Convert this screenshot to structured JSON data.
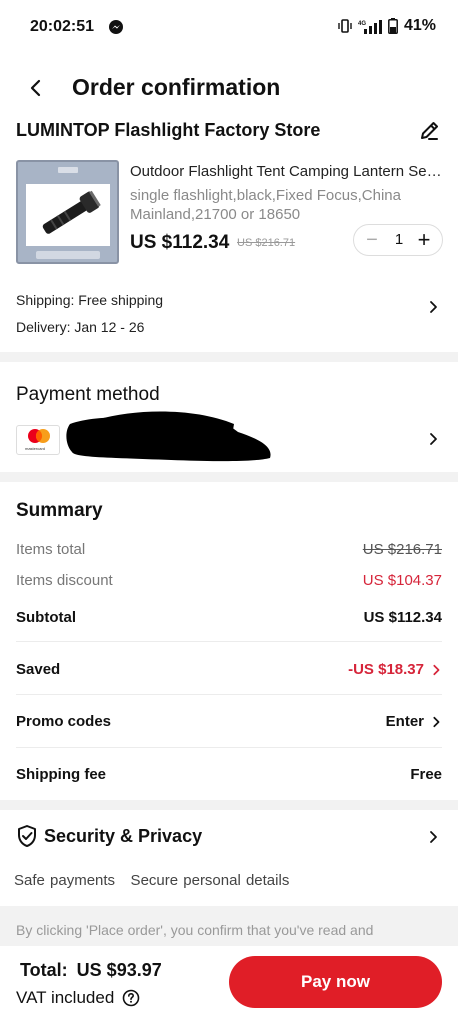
{
  "status_bar": {
    "time": "20:02:51",
    "battery": "41%"
  },
  "header": {
    "title": "Order confirmation"
  },
  "store": {
    "name": "LUMINTOP Flashlight Factory Store"
  },
  "product": {
    "title": "Outdoor Flashlight Tent Camping Lantern Searchlight",
    "spec": "single flashlight,black,Fixed Focus,China Mainland,21700 or 18650",
    "price": "US $112.34",
    "original_price": "US $216.71",
    "quantity": "1",
    "minus": "−",
    "plus": "+"
  },
  "shipping": {
    "shipping_text": "Shipping: Free shipping",
    "delivery_text": "Delivery: Jan 12 - 26"
  },
  "payment": {
    "title": "Payment method",
    "card_brand": "mastercard"
  },
  "summary": {
    "title": "Summary",
    "items_total_label": "Items total",
    "items_total_value": "US $216.71",
    "items_discount_label": "Items discount",
    "items_discount_value": "US $104.37",
    "subtotal_label": "Subtotal",
    "subtotal_value": "US $112.34",
    "saved_label": "Saved",
    "saved_value": "-US $18.37",
    "promo_label": "Promo codes",
    "promo_value": "Enter",
    "shipping_fee_label": "Shipping fee",
    "shipping_fee_value": "Free"
  },
  "security": {
    "title": "Security & Privacy",
    "subtitle": "Safe payments   Secure personal details"
  },
  "consent": {
    "text": "By clicking 'Place order', you confirm that you've read and"
  },
  "footer": {
    "total_label": "Total:",
    "total_value": "US $93.97",
    "vat_text": "VAT included",
    "pay_button": "Pay now"
  },
  "colors": {
    "accent_red": "#e01e27",
    "discount_red": "#d6253a"
  }
}
